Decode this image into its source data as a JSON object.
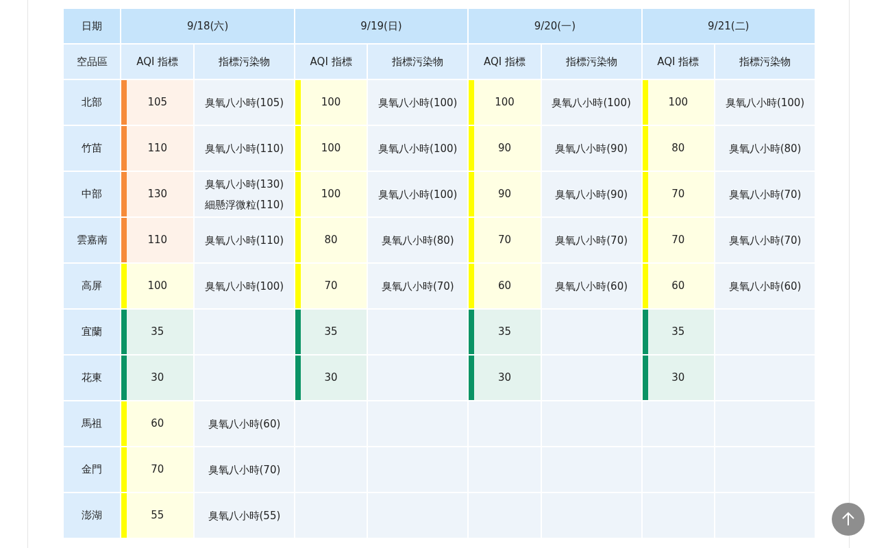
{
  "table": {
    "date_label": "日期",
    "region_label": "空品區",
    "dates": [
      {
        "date": "9/18(六)",
        "aqi_label": "AQI 指標",
        "pollutant_label": "指標污染物"
      },
      {
        "date": "9/19(日)",
        "aqi_label": "AQI 指標",
        "pollutant_label": "指標污染物"
      },
      {
        "date": "9/20(一)",
        "aqi_label": "AQI 指標",
        "pollutant_label": "指標污染物"
      },
      {
        "date": "9/21(二)",
        "aqi_label": "AQI 指標",
        "pollutant_label": "指標污染物"
      }
    ],
    "rows": [
      {
        "region": "北部",
        "days": [
          {
            "aqi": "105",
            "color": "#f68b3a",
            "pollutants": [
              "臭氧八小時(105)"
            ]
          },
          {
            "aqi": "100",
            "color": "#ffff00",
            "pollutants": [
              "臭氧八小時(100)"
            ]
          },
          {
            "aqi": "100",
            "color": "#ffff00",
            "pollutants": [
              "臭氧八小時(100)"
            ]
          },
          {
            "aqi": "100",
            "color": "#ffff00",
            "pollutants": [
              "臭氧八小時(100)"
            ]
          }
        ]
      },
      {
        "region": "竹苗",
        "days": [
          {
            "aqi": "110",
            "color": "#f68b3a",
            "pollutants": [
              "臭氧八小時(110)"
            ]
          },
          {
            "aqi": "100",
            "color": "#ffff00",
            "pollutants": [
              "臭氧八小時(100)"
            ]
          },
          {
            "aqi": "90",
            "color": "#ffff00",
            "pollutants": [
              "臭氧八小時(90)"
            ]
          },
          {
            "aqi": "80",
            "color": "#ffff00",
            "pollutants": [
              "臭氧八小時(80)"
            ]
          }
        ]
      },
      {
        "region": "中部",
        "days": [
          {
            "aqi": "130",
            "color": "#f68b3a",
            "pollutants": [
              "臭氧八小時(130)",
              "細懸浮微粒(110)"
            ]
          },
          {
            "aqi": "100",
            "color": "#ffff00",
            "pollutants": [
              "臭氧八小時(100)"
            ]
          },
          {
            "aqi": "90",
            "color": "#ffff00",
            "pollutants": [
              "臭氧八小時(90)"
            ]
          },
          {
            "aqi": "70",
            "color": "#ffff00",
            "pollutants": [
              "臭氧八小時(70)"
            ]
          }
        ]
      },
      {
        "region": "雲嘉南",
        "days": [
          {
            "aqi": "110",
            "color": "#f68b3a",
            "pollutants": [
              "臭氧八小時(110)"
            ]
          },
          {
            "aqi": "80",
            "color": "#ffff00",
            "pollutants": [
              "臭氧八小時(80)"
            ]
          },
          {
            "aqi": "70",
            "color": "#ffff00",
            "pollutants": [
              "臭氧八小時(70)"
            ]
          },
          {
            "aqi": "70",
            "color": "#ffff00",
            "pollutants": [
              "臭氧八小時(70)"
            ]
          }
        ]
      },
      {
        "region": "高屏",
        "days": [
          {
            "aqi": "100",
            "color": "#ffff00",
            "pollutants": [
              "臭氧八小時(100)"
            ]
          },
          {
            "aqi": "70",
            "color": "#ffff00",
            "pollutants": [
              "臭氧八小時(70)"
            ]
          },
          {
            "aqi": "60",
            "color": "#ffff00",
            "pollutants": [
              "臭氧八小時(60)"
            ]
          },
          {
            "aqi": "60",
            "color": "#ffff00",
            "pollutants": [
              "臭氧八小時(60)"
            ]
          }
        ]
      },
      {
        "region": "宜蘭",
        "days": [
          {
            "aqi": "35",
            "color": "#0a9365"
          },
          {
            "aqi": "35",
            "color": "#0a9365"
          },
          {
            "aqi": "35",
            "color": "#0a9365"
          },
          {
            "aqi": "35",
            "color": "#0a9365"
          }
        ]
      },
      {
        "region": "花東",
        "days": [
          {
            "aqi": "30",
            "color": "#0a9365"
          },
          {
            "aqi": "30",
            "color": "#0a9365"
          },
          {
            "aqi": "30",
            "color": "#0a9365"
          },
          {
            "aqi": "30",
            "color": "#0a9365"
          }
        ]
      },
      {
        "region": "馬祖",
        "days": [
          {
            "aqi": "60",
            "color": "#ffff00",
            "pollutants": [
              "臭氧八小時(60)"
            ]
          }
        ]
      },
      {
        "region": "金門",
        "days": [
          {
            "aqi": "70",
            "color": "#ffff00",
            "pollutants": [
              "臭氧八小時(70)"
            ]
          }
        ]
      },
      {
        "region": "澎湖",
        "days": [
          {
            "aqi": "55",
            "color": "#ffff00",
            "pollutants": [
              "臭氧八小時(55)"
            ]
          }
        ]
      }
    ]
  }
}
